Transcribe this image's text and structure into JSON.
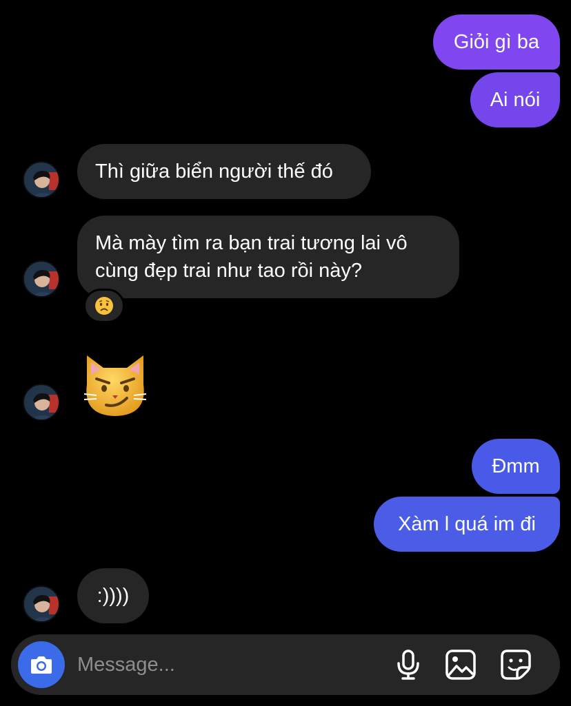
{
  "thread": {
    "messages": [
      {
        "from": "me",
        "text": "Giỏi gì ba",
        "color": "#8046f0"
      },
      {
        "from": "me",
        "text": "Ai nói",
        "color": "#7446ec"
      },
      {
        "from": "them",
        "text": "Thì giữa biển người thế đó"
      },
      {
        "from": "them",
        "text_line1": "Mà mày tìm ra bạn trai tương lai vô",
        "text_line2": "cùng đẹp trai như tao rồi này?",
        "reaction": "😟"
      },
      {
        "from": "them",
        "emoji": "😼"
      },
      {
        "from": "me",
        "text": "Đmm",
        "color": "#4a5ae8"
      },
      {
        "from": "me",
        "text": "Xàm l quá im đi",
        "color": "#4b5de6"
      },
      {
        "from": "them",
        "text": ":))))"
      }
    ]
  },
  "composer": {
    "placeholder": "Message...",
    "icons": [
      "camera-icon",
      "microphone-icon",
      "image-icon",
      "sticker-icon"
    ],
    "accent": "#3b6be8"
  }
}
